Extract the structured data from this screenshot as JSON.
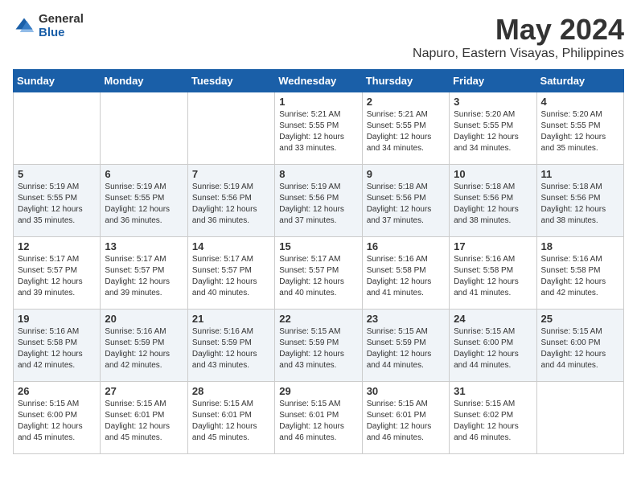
{
  "logo": {
    "general": "General",
    "blue": "Blue"
  },
  "title": "May 2024",
  "subtitle": "Napuro, Eastern Visayas, Philippines",
  "days_header": [
    "Sunday",
    "Monday",
    "Tuesday",
    "Wednesday",
    "Thursday",
    "Friday",
    "Saturday"
  ],
  "weeks": [
    [
      {
        "day": "",
        "info": ""
      },
      {
        "day": "",
        "info": ""
      },
      {
        "day": "",
        "info": ""
      },
      {
        "day": "1",
        "info": "Sunrise: 5:21 AM\nSunset: 5:55 PM\nDaylight: 12 hours and 33 minutes."
      },
      {
        "day": "2",
        "info": "Sunrise: 5:21 AM\nSunset: 5:55 PM\nDaylight: 12 hours and 34 minutes."
      },
      {
        "day": "3",
        "info": "Sunrise: 5:20 AM\nSunset: 5:55 PM\nDaylight: 12 hours and 34 minutes."
      },
      {
        "day": "4",
        "info": "Sunrise: 5:20 AM\nSunset: 5:55 PM\nDaylight: 12 hours and 35 minutes."
      }
    ],
    [
      {
        "day": "5",
        "info": "Sunrise: 5:19 AM\nSunset: 5:55 PM\nDaylight: 12 hours and 35 minutes."
      },
      {
        "day": "6",
        "info": "Sunrise: 5:19 AM\nSunset: 5:55 PM\nDaylight: 12 hours and 36 minutes."
      },
      {
        "day": "7",
        "info": "Sunrise: 5:19 AM\nSunset: 5:56 PM\nDaylight: 12 hours and 36 minutes."
      },
      {
        "day": "8",
        "info": "Sunrise: 5:19 AM\nSunset: 5:56 PM\nDaylight: 12 hours and 37 minutes."
      },
      {
        "day": "9",
        "info": "Sunrise: 5:18 AM\nSunset: 5:56 PM\nDaylight: 12 hours and 37 minutes."
      },
      {
        "day": "10",
        "info": "Sunrise: 5:18 AM\nSunset: 5:56 PM\nDaylight: 12 hours and 38 minutes."
      },
      {
        "day": "11",
        "info": "Sunrise: 5:18 AM\nSunset: 5:56 PM\nDaylight: 12 hours and 38 minutes."
      }
    ],
    [
      {
        "day": "12",
        "info": "Sunrise: 5:17 AM\nSunset: 5:57 PM\nDaylight: 12 hours and 39 minutes."
      },
      {
        "day": "13",
        "info": "Sunrise: 5:17 AM\nSunset: 5:57 PM\nDaylight: 12 hours and 39 minutes."
      },
      {
        "day": "14",
        "info": "Sunrise: 5:17 AM\nSunset: 5:57 PM\nDaylight: 12 hours and 40 minutes."
      },
      {
        "day": "15",
        "info": "Sunrise: 5:17 AM\nSunset: 5:57 PM\nDaylight: 12 hours and 40 minutes."
      },
      {
        "day": "16",
        "info": "Sunrise: 5:16 AM\nSunset: 5:58 PM\nDaylight: 12 hours and 41 minutes."
      },
      {
        "day": "17",
        "info": "Sunrise: 5:16 AM\nSunset: 5:58 PM\nDaylight: 12 hours and 41 minutes."
      },
      {
        "day": "18",
        "info": "Sunrise: 5:16 AM\nSunset: 5:58 PM\nDaylight: 12 hours and 42 minutes."
      }
    ],
    [
      {
        "day": "19",
        "info": "Sunrise: 5:16 AM\nSunset: 5:58 PM\nDaylight: 12 hours and 42 minutes."
      },
      {
        "day": "20",
        "info": "Sunrise: 5:16 AM\nSunset: 5:59 PM\nDaylight: 12 hours and 42 minutes."
      },
      {
        "day": "21",
        "info": "Sunrise: 5:16 AM\nSunset: 5:59 PM\nDaylight: 12 hours and 43 minutes."
      },
      {
        "day": "22",
        "info": "Sunrise: 5:15 AM\nSunset: 5:59 PM\nDaylight: 12 hours and 43 minutes."
      },
      {
        "day": "23",
        "info": "Sunrise: 5:15 AM\nSunset: 5:59 PM\nDaylight: 12 hours and 44 minutes."
      },
      {
        "day": "24",
        "info": "Sunrise: 5:15 AM\nSunset: 6:00 PM\nDaylight: 12 hours and 44 minutes."
      },
      {
        "day": "25",
        "info": "Sunrise: 5:15 AM\nSunset: 6:00 PM\nDaylight: 12 hours and 44 minutes."
      }
    ],
    [
      {
        "day": "26",
        "info": "Sunrise: 5:15 AM\nSunset: 6:00 PM\nDaylight: 12 hours and 45 minutes."
      },
      {
        "day": "27",
        "info": "Sunrise: 5:15 AM\nSunset: 6:01 PM\nDaylight: 12 hours and 45 minutes."
      },
      {
        "day": "28",
        "info": "Sunrise: 5:15 AM\nSunset: 6:01 PM\nDaylight: 12 hours and 45 minutes."
      },
      {
        "day": "29",
        "info": "Sunrise: 5:15 AM\nSunset: 6:01 PM\nDaylight: 12 hours and 46 minutes."
      },
      {
        "day": "30",
        "info": "Sunrise: 5:15 AM\nSunset: 6:01 PM\nDaylight: 12 hours and 46 minutes."
      },
      {
        "day": "31",
        "info": "Sunrise: 5:15 AM\nSunset: 6:02 PM\nDaylight: 12 hours and 46 minutes."
      },
      {
        "day": "",
        "info": ""
      }
    ]
  ]
}
